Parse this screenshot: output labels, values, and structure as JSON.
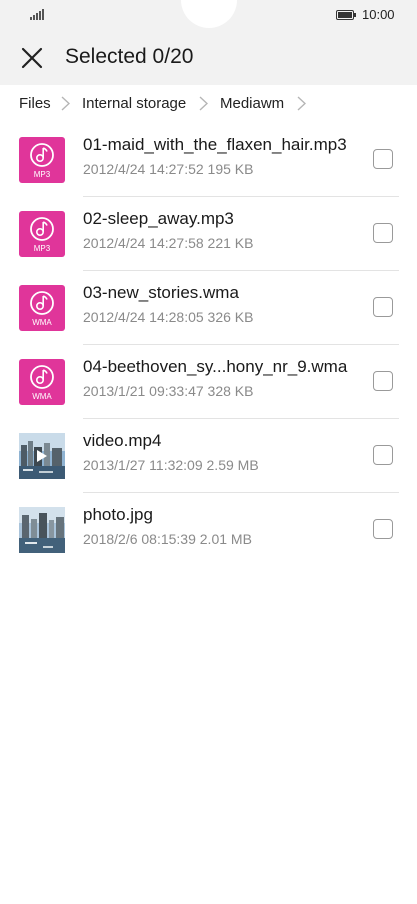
{
  "status_bar": {
    "time": "10:00",
    "signal_icon": "signal-icon",
    "battery_icon": "battery-icon"
  },
  "header": {
    "close_icon": "close-icon",
    "title": "Selected 0/20"
  },
  "breadcrumb": [
    "Files",
    "Internal storage",
    "Mediawm"
  ],
  "files": [
    {
      "name": "01-maid_with_the_flaxen_hair.mp3",
      "meta": "2012/4/24 14:27:52 195 KB",
      "type": "MP3",
      "icon": "music-file-icon"
    },
    {
      "name": "02-sleep_away.mp3",
      "meta": "2012/4/24 14:27:58 221 KB",
      "type": "MP3",
      "icon": "music-file-icon"
    },
    {
      "name": "03-new_stories.wma",
      "meta": "2012/4/24 14:28:05 326 KB",
      "type": "WMA",
      "icon": "music-file-icon"
    },
    {
      "name": "04-beethoven_sy...hony_nr_9.wma",
      "meta": "2013/1/21 09:33:47 328 KB",
      "type": "WMA",
      "icon": "music-file-icon"
    },
    {
      "name": "video.mp4",
      "meta": "2013/1/27 11:32:09 2.59 MB",
      "type": "",
      "icon": "video-thumbnail"
    },
    {
      "name": "photo.jpg",
      "meta": "2018/2/6 08:15:39 2.01 MB",
      "type": "",
      "icon": "photo-thumbnail"
    }
  ],
  "colors": {
    "accent": "#e0359a",
    "top_background": "#f2f2f2",
    "meta_text": "#8a8a8a",
    "divider": "#e3e3e3"
  }
}
